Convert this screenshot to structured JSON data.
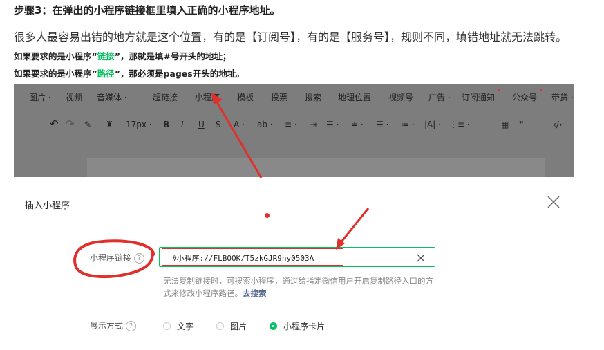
{
  "article": {
    "step_title": "步骤3：在弹出的小程序链接框里填入正确的小程序地址。",
    "paragraph": "很多人最容易出错的地方就是这个位置，有的是【订阅号】，有的是【服务号】，规则不同，填错地址就无法跳转。",
    "rule1": {
      "prefix": "如果要求的是小程序“",
      "keyword": "链接",
      "suffix": "”，那就是填#号开头的地址；"
    },
    "rule2": {
      "prefix": "如果要求的是小程序”",
      "keyword": "路径",
      "suffix": "”，那必须是pages开头的地址。"
    }
  },
  "editor": {
    "menu": [
      "图片 ·",
      "视频",
      "音媒体 ·",
      "超链接",
      "小程序",
      "模板",
      "投票",
      "搜索",
      "地理位置",
      "视频号",
      "广告 ·",
      "订阅通知",
      "公众号",
      "带货 ·"
    ],
    "toolbar": {
      "undo_icon": "↶",
      "redo_icon": "↷",
      "brush_icon": "✎",
      "eraser_icon": "♜",
      "font_size": "17px ·",
      "bold": "B",
      "italic": "I",
      "underline": "U",
      "strike": "S",
      "font_color": "A ·",
      "bg_color": "ab ·",
      "align1": "≡ ·",
      "indent": "⇥",
      "spacing": "☰ ·",
      "lineheight": "≐ ·",
      "list": "☰ ·",
      "para": "≔ ·",
      "textdir": "|A| ·",
      "ul": "⋮≡ ·",
      "table": "▦",
      "quote": "❞",
      "hr": "—",
      "code": "‹/›"
    }
  },
  "dialog": {
    "title": "插入小程序",
    "link_label": "小程序链接",
    "help_glyph": "?",
    "link_value": "#小程序://FLBOOK/T5zkGJR9hy0503A",
    "hint_text": "无法复制链接时，可搜索小程序，通过给指定微信用户开启复制路径入口的方式来修改小程序路径。",
    "hint_link": "去搜索",
    "display_label": "展示方式",
    "display_options": [
      "文字",
      "图片",
      "小程序卡片"
    ],
    "display_selected": "小程序卡片"
  },
  "colors": {
    "accent_green": "#07c160",
    "annotation_red": "#e0302b",
    "link_blue": "#576b95"
  }
}
